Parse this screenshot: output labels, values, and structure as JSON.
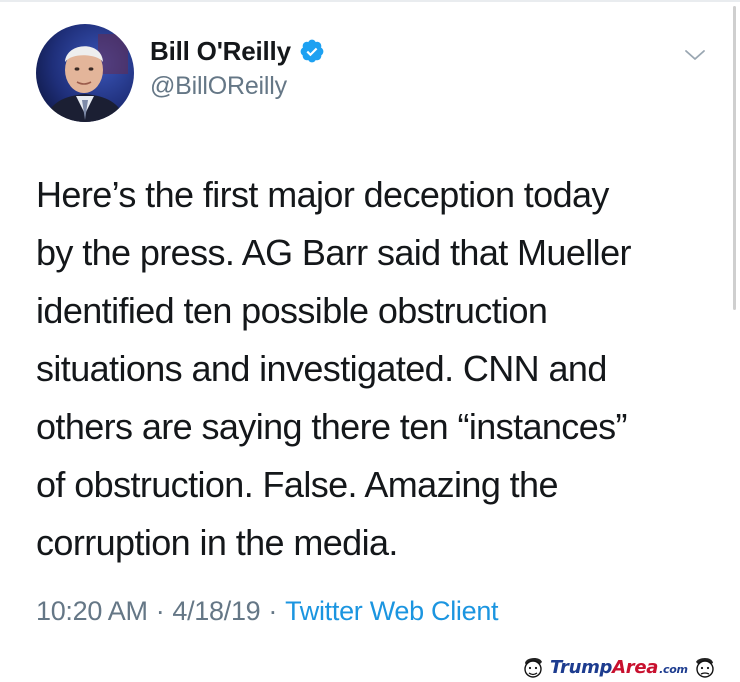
{
  "author": {
    "display_name": "Bill O'Reilly",
    "handle": "@BillOReilly",
    "verified": true,
    "avatar_icon": "profile-photo"
  },
  "tweet": {
    "text": "Here’s the first major deception today\nby the press.  AG Barr said that Mueller\nidentified ten possible obstruction\nsituations and investigated.  CNN and\nothers are saying there ten “instances”\nof obstruction.  False.  Amazing the\ncorruption in the media.",
    "time": "10:20 AM",
    "date": "4/18/19",
    "separator": "·",
    "source": "Twitter Web Client"
  },
  "watermark": {
    "part1": "Trump",
    "part2": "Area",
    "part3": ".com"
  },
  "colors": {
    "text": "#14171a",
    "secondary": "#657786",
    "link": "#1b95e0",
    "verified": "#1da1f2"
  },
  "icons": [
    "verified-badge-icon",
    "chevron-down-icon",
    "cartoon-face-icon"
  ]
}
